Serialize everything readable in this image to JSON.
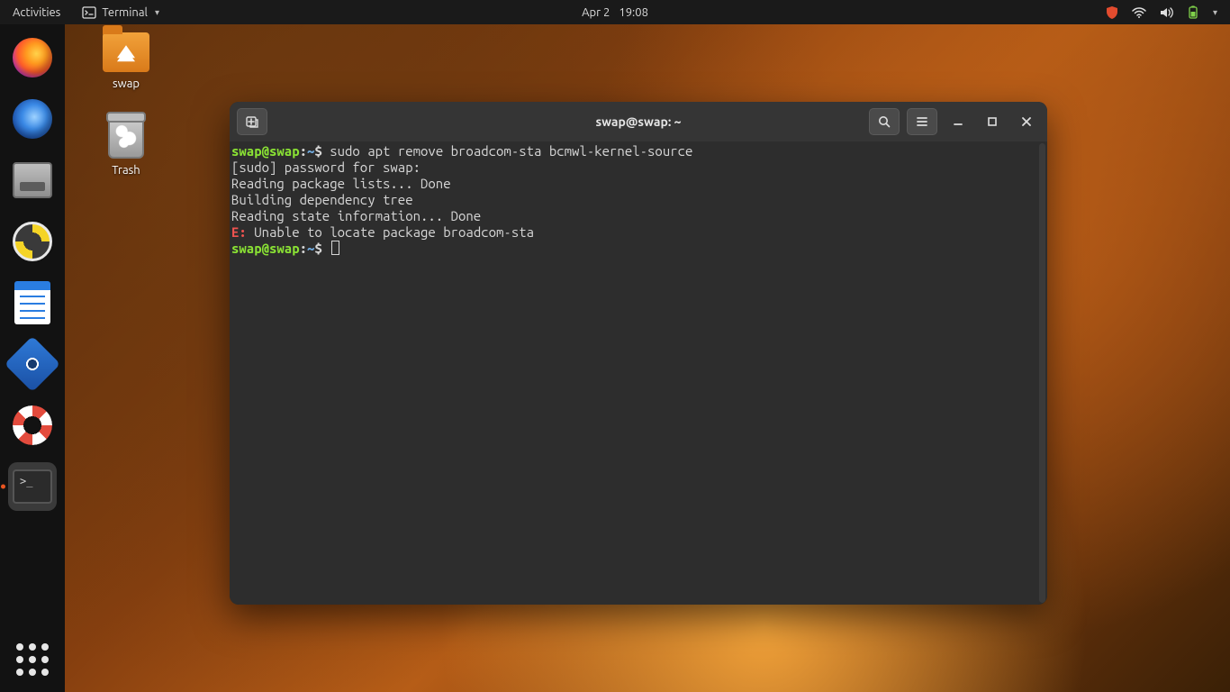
{
  "panel": {
    "activities": "Activities",
    "app_menu_label": "Terminal",
    "date": "Apr 2",
    "time": "19:08"
  },
  "desktop": {
    "home_label": "swap",
    "trash_label": "Trash"
  },
  "window": {
    "title": "swap@swap: ~"
  },
  "terminal": {
    "prompt_user": "swap@swap",
    "prompt_path": "~",
    "prompt_symbol": "$",
    "command1": "sudo apt remove broadcom-sta bcmwl-kernel-source",
    "line_sudo": "[sudo] password for swap:",
    "line_read": "Reading package lists... Done",
    "line_build": "Building dependency tree",
    "line_state": "Reading state information... Done",
    "err_prefix": "E:",
    "err_msg": " Unable to locate package broadcom-sta"
  }
}
